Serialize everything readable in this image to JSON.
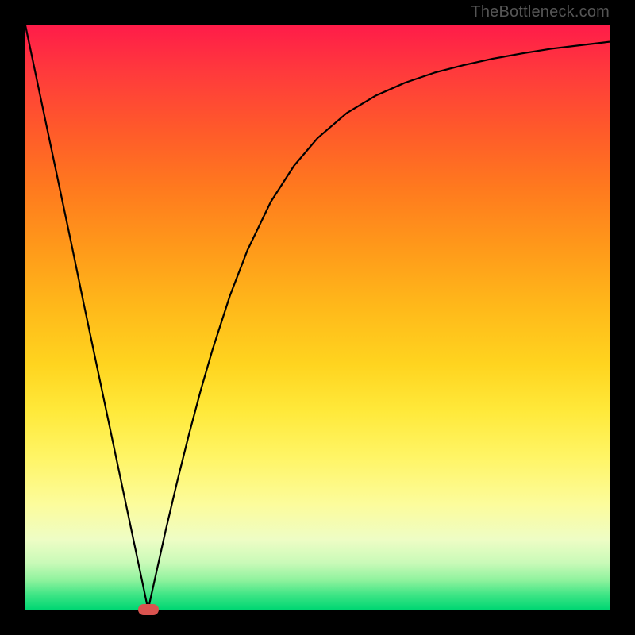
{
  "watermark": "TheBottleneck.com",
  "chart_data": {
    "type": "line",
    "title": "",
    "xlabel": "",
    "ylabel": "",
    "xlim": [
      0,
      100
    ],
    "ylim": [
      0,
      100
    ],
    "x": [
      0,
      2,
      4,
      6,
      8,
      10,
      12,
      14,
      16,
      18,
      20,
      21,
      22,
      24,
      26,
      28,
      30,
      32,
      35,
      38,
      42,
      46,
      50,
      55,
      60,
      65,
      70,
      75,
      80,
      85,
      90,
      95,
      100
    ],
    "values": [
      100,
      90.5,
      81,
      71.5,
      62,
      52.3,
      42.8,
      33.3,
      23.8,
      14.3,
      4.8,
      0,
      4.5,
      13.5,
      22,
      30,
      37.5,
      44.4,
      53.7,
      61.5,
      69.8,
      76,
      80.7,
      85,
      88,
      90.2,
      91.9,
      93.2,
      94.3,
      95.2,
      96,
      96.6,
      97.2
    ],
    "marker": {
      "x": 21,
      "y": 0
    },
    "grid": false,
    "legend": false
  },
  "colors": {
    "frame": "#000000",
    "curve": "#000000",
    "marker": "#d9534f",
    "watermark": "#555555"
  }
}
